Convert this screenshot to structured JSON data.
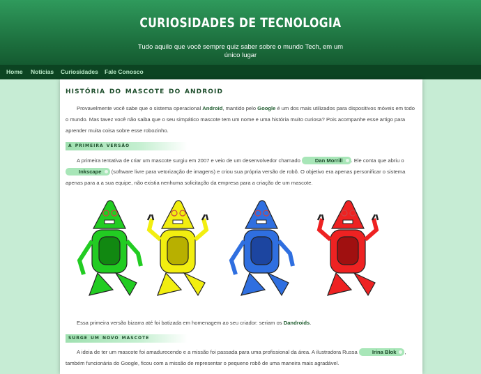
{
  "header": {
    "title": "CURIOSIDADES DE TECNOLOGIA",
    "subtitle": "Tudo aquilo que você sempre quiz saber sobre o mundo Tech, em um único lugar"
  },
  "nav": {
    "items": [
      {
        "label": "Home"
      },
      {
        "label": "Notícias"
      },
      {
        "label": "Curiosidades"
      },
      {
        "label": "Fale Conosco"
      }
    ]
  },
  "article": {
    "title": "História do Mascote do Android",
    "intro": {
      "t1": "Provavelmente você sabe que o sistema operacional ",
      "k1": "Android",
      "t2": ", mantido pelo ",
      "k2": "Google",
      "t3": " é um dos mais utilizados para dispositivos móveis em todo o mundo. Mas tavez você não saiba que o seu simpático mascote tem um nome e uma história muito curiosa? Pois acompanhe esse artigo para aprender muita coisa sobre esse robozinho."
    },
    "section1": {
      "heading": "A Primeira Versão",
      "t1": "A primeira tentativa de criar um mascote surgiu em 2007 e veio de um desenvolvedor chamado ",
      "tag1": "Dan Morrill",
      "t2": ". Ele conta que abriu o ",
      "tag2": "Inkscape",
      "t3": " (software livre para vetorização de imagens) e criou sua própria versão de robô. O objetivo era apenas personificar o sistema apenas para a a sua equipe, não existia nenhuma solicitação da empresa para a criação de um mascote.",
      "caption_t1": "Essa primeira versão bizarra até foi batizada em homenagem ao seu criador: seriam os ",
      "caption_k1": "Dandroids",
      "caption_t2": "."
    },
    "section2": {
      "heading": "Surge um Novo Mascote",
      "t1": "A ideia de ter um mascote foi amadurecendo e a missão foi passada para uma profissional da área. A ilustradora Russa ",
      "tag1": "Irina Blok",
      "t2": ", também funcionária do Google, ficou com a missão de representar o pequeno robô de uma maneira mais agradável."
    },
    "robots": [
      {
        "color": "#22cc22",
        "dark": "#118811"
      },
      {
        "color": "#f2ee10",
        "dark": "#b8b000"
      },
      {
        "color": "#2f6fe0",
        "dark": "#1c45a0"
      },
      {
        "color": "#ee2222",
        "dark": "#a01010"
      }
    ]
  }
}
